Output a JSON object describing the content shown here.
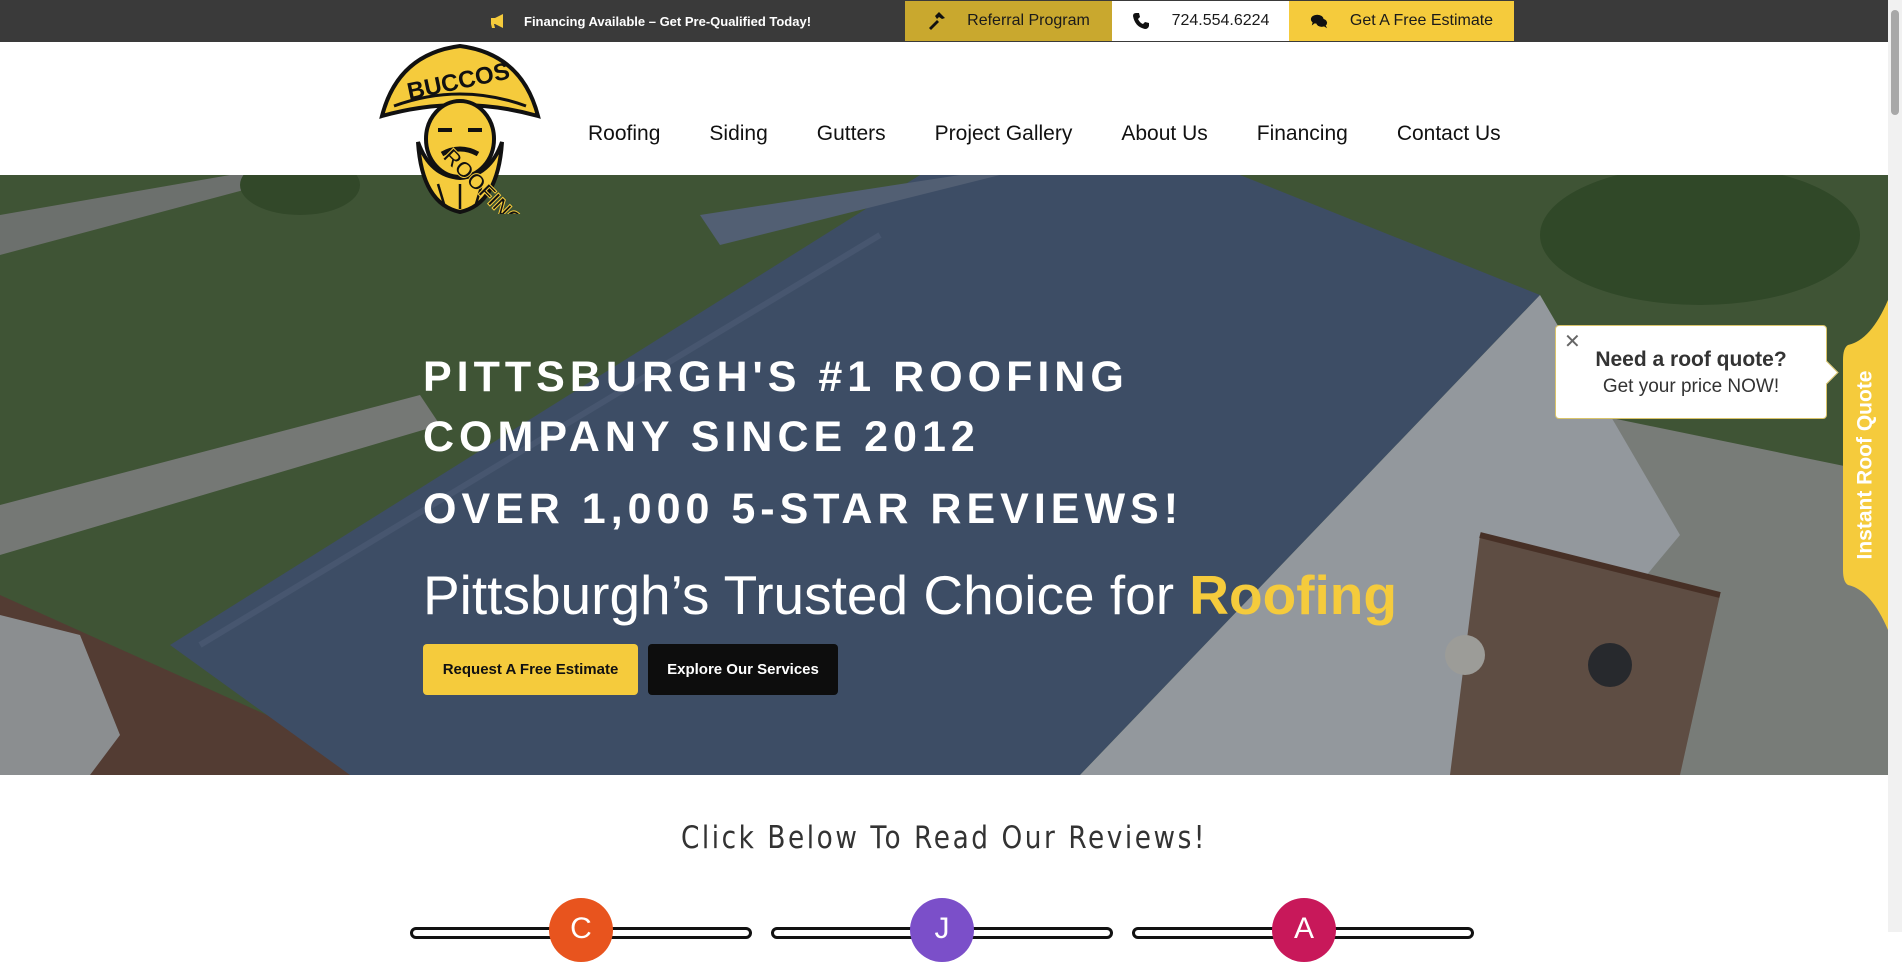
{
  "topbar": {
    "promo_text": "Financing Available – Get Pre-Qualified Today!",
    "promo_icon": "megaphone-icon",
    "referral_label": "Referral Program",
    "phone_label": "724.554.6224",
    "estimate_label": "Get A Free Estimate"
  },
  "logo": {
    "line1": "BUCCOS",
    "line2": "ROOFING"
  },
  "nav": {
    "items": [
      "Roofing",
      "Siding",
      "Gutters",
      "Project Gallery",
      "About Us",
      "Financing",
      "Contact Us"
    ]
  },
  "hero": {
    "headline": "PITTSBURGH'S #1 ROOFING COMPANY SINCE 2012",
    "subheadline": "OVER 1,000 5-STAR REVIEWS!",
    "tagline_prefix": "Pittsburgh’s Trusted Choice for",
    "tagline_highlight": "Roofing",
    "primary_button": "Request A Free Estimate",
    "secondary_button": "Explore Our Services"
  },
  "quote_popup": {
    "close": "✕",
    "title": "Need a roof quote?",
    "subtitle": "Get your price NOW!",
    "side_tab": "Instant Roof Quote"
  },
  "reviews": {
    "title": "Click Below To Read Our Reviews!",
    "avatars": [
      {
        "letter": "C",
        "color": "#e8541e"
      },
      {
        "letter": "J",
        "color": "#7b4fc9"
      },
      {
        "letter": "A",
        "color": "#c8185a"
      }
    ]
  },
  "colors": {
    "brand_yellow": "#f5cb3c",
    "topbar": "#3a3a3a",
    "referral": "#c9a82e"
  }
}
